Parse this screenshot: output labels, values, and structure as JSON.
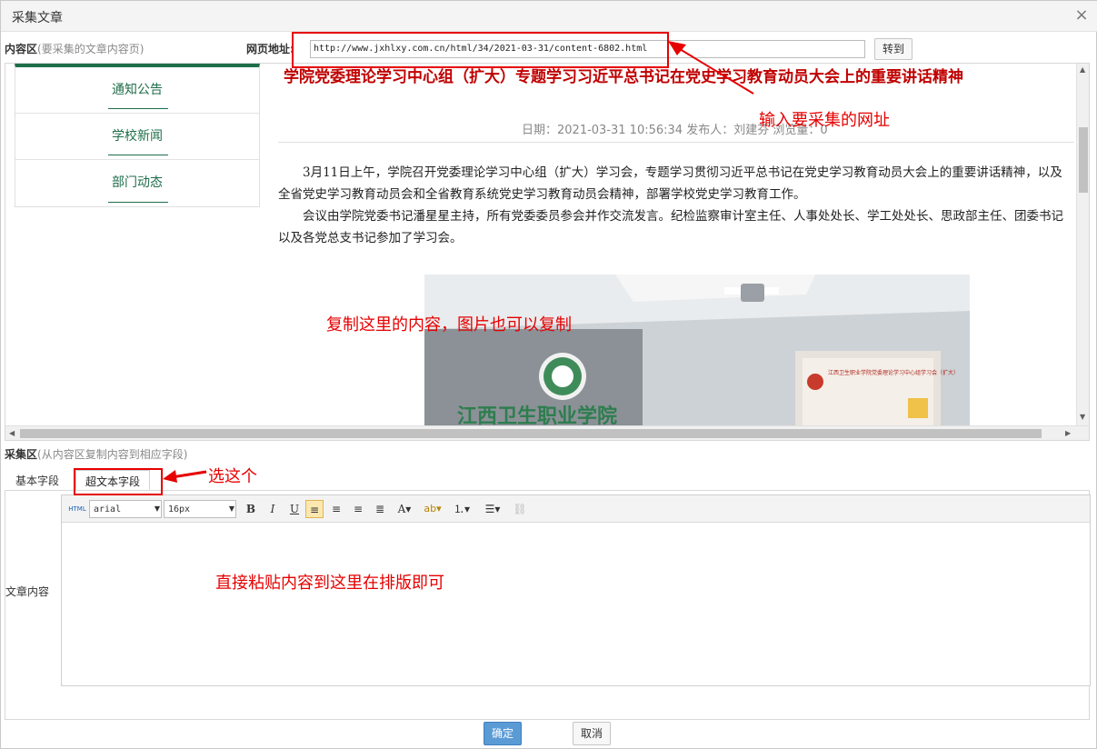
{
  "dialog": {
    "title": "采集文章"
  },
  "content_area": {
    "label": "内容区",
    "hint": "(要采集的文章内容页)"
  },
  "url_bar": {
    "label": "网页地址:",
    "value": "http://www.jxhlxy.com.cn/html/34/2021-03-31/content-6802.html",
    "go_label": "转到"
  },
  "page": {
    "nav": [
      "通知公告",
      "学校新闻",
      "部门动态"
    ],
    "title": "学院党委理论学习中心组（扩大）专题学习习近平总书记在党史学习教育动员大会上的重要讲话精神",
    "meta": "日期：2021-03-31 10:56:34  发布人：刘建芬  浏览量：0",
    "paragraphs": [
      "3月11日上午，学院召开党委理论学习中心组（扩大）学习会，专题学习贯彻习近平总书记在党史学习教育动员大会上的重要讲话精神，以及全省党史学习教育动员会和全省教育系统党史学习教育动员会精神，部署学校党史学习教育工作。",
      "会议由学院党委书记潘星星主持，所有党委委员参会并作交流发言。纪检监察审计室主任、人事处处长、学工处处长、思政部主任、团委书记以及各党总支书记参加了学习会。"
    ],
    "photo": {
      "wall_text": "江西卫生职业学院",
      "screen_text": "江西卫生职业学院党委理论学习中心组学习会（扩大）"
    }
  },
  "collect_area": {
    "label": "采集区",
    "hint": "(从内容区复制内容到相应字段)"
  },
  "tabs": [
    {
      "label": "基本字段"
    },
    {
      "label": "超文本字段"
    }
  ],
  "field": {
    "label": "文章内容"
  },
  "editor": {
    "html_label": "HTML",
    "font": "arial",
    "size": "16px"
  },
  "footer": {
    "ok": "确定",
    "cancel": "取消"
  },
  "annotations": {
    "url": "输入要采集的网址",
    "copy": "复制这里的内容，图片也可以复制",
    "tab": "选这个",
    "paste": "直接粘贴内容到这里在排版即可"
  }
}
